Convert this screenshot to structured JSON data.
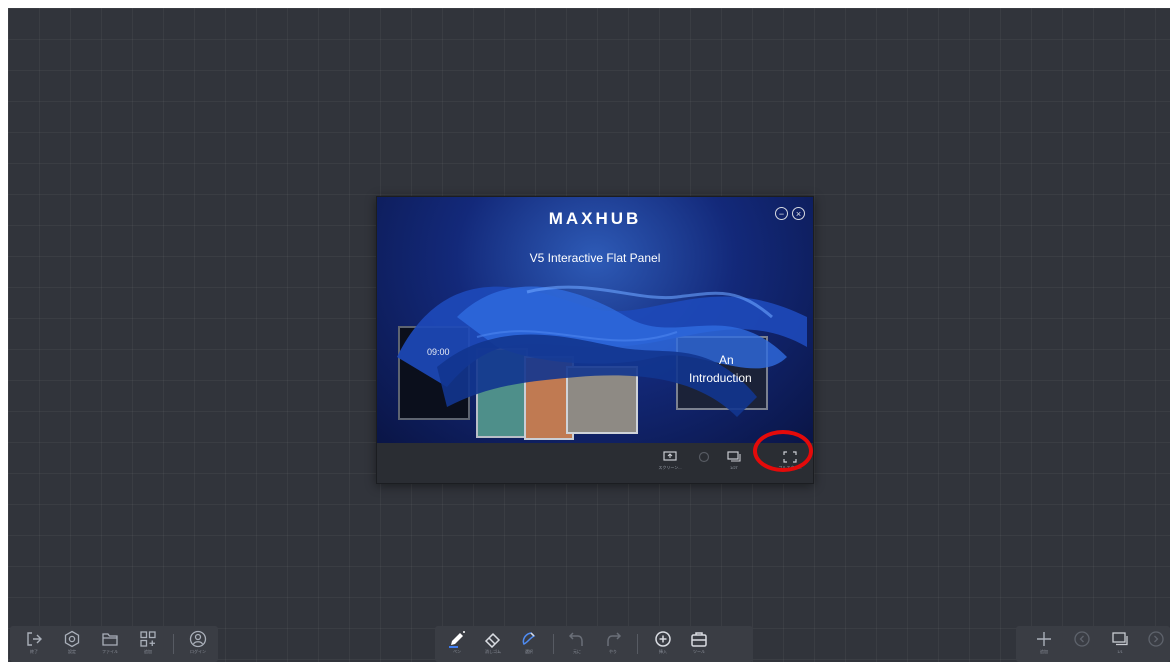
{
  "media_window": {
    "brand": "MAXHUB",
    "product_title": "V5 Interactive Flat Panel",
    "clock_text": "09:00",
    "intro_line1": "An",
    "intro_line2": "Introduction",
    "minimize_icon": "−",
    "close_icon": "×",
    "toolbar": [
      {
        "icon": "screen-share-icon",
        "label": "スクリーン..."
      },
      {
        "icon": "annotate-icon",
        "label": ""
      },
      {
        "icon": "window-icon",
        "label": "1/2T"
      },
      {
        "icon": "fullscreen-icon",
        "label": "フルスクリ..."
      }
    ]
  },
  "highlight_color": "#e40a0a",
  "left_bar": [
    {
      "icon": "exit-icon",
      "label": "終了"
    },
    {
      "icon": "settings-icon",
      "label": "設定"
    },
    {
      "icon": "folder-icon",
      "label": "ファイル"
    },
    {
      "icon": "apps-icon",
      "label": "追加"
    },
    {
      "icon": "account-icon",
      "label": "ログイン"
    }
  ],
  "center_bar": [
    {
      "icon": "pen-icon",
      "label": "ペン"
    },
    {
      "icon": "eraser-icon",
      "label": "消しゴム"
    },
    {
      "icon": "select-icon",
      "label": "選択"
    },
    {
      "icon": "undo-icon",
      "label": "元に"
    },
    {
      "icon": "redo-icon",
      "label": "やり"
    },
    {
      "icon": "insert-icon",
      "label": "挿入"
    },
    {
      "icon": "toolbox-icon",
      "label": "ツール"
    }
  ],
  "right_bar": [
    {
      "icon": "add-page-icon",
      "label": "追加"
    },
    {
      "icon": "prev-page-icon",
      "label": ""
    },
    {
      "icon": "pages-icon",
      "label": "1/1"
    },
    {
      "icon": "next-page-icon",
      "label": ""
    }
  ]
}
